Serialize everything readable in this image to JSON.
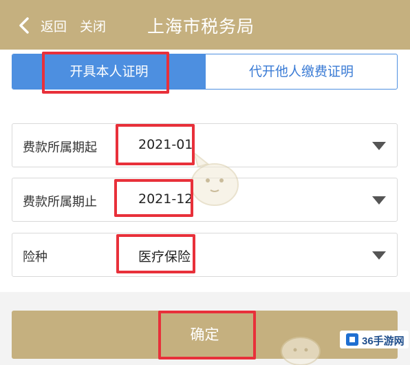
{
  "header": {
    "back_label": "返回",
    "close_label": "关闭",
    "title": "上海市税务局"
  },
  "tabs": [
    {
      "label": "开具本人证明",
      "active": true
    },
    {
      "label": "代开他人缴费证明",
      "active": false
    }
  ],
  "form": {
    "fields": [
      {
        "label": "费款所属期起",
        "value": "2021-01"
      },
      {
        "label": "费款所属期止",
        "value": "2021-12"
      },
      {
        "label": "险种",
        "value": "医疗保险"
      }
    ]
  },
  "confirm_label": "确定",
  "watermark": {
    "text": "36手游网"
  },
  "colors": {
    "header": "#c5b07f",
    "accent": "#4d8fe0",
    "highlight": "#e8303a"
  }
}
